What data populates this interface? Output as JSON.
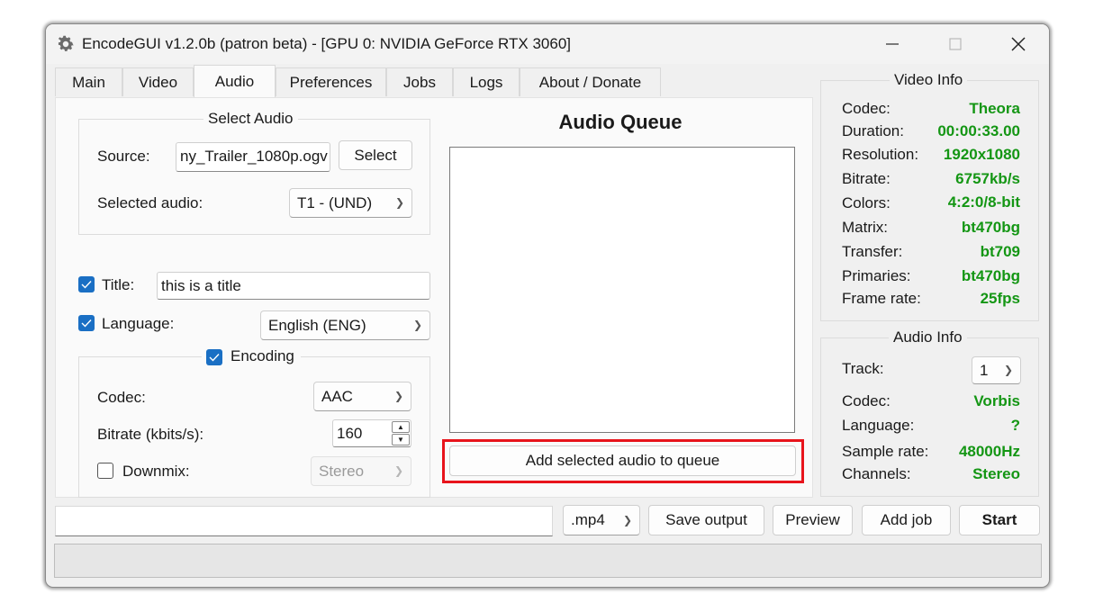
{
  "window": {
    "title": "EncodeGUI v1.2.0b (patron beta) - [GPU 0: NVIDIA GeForce RTX 3060]",
    "icons": {
      "app": "gear-icon",
      "minimize": "minimize-icon",
      "maximize": "maximize-icon",
      "close": "close-icon"
    }
  },
  "tabs": [
    {
      "label": "Main"
    },
    {
      "label": "Video"
    },
    {
      "label": "Audio",
      "active": true
    },
    {
      "label": "Preferences"
    },
    {
      "label": "Jobs"
    },
    {
      "label": "Logs"
    },
    {
      "label": "About / Donate"
    }
  ],
  "select_audio": {
    "legend": "Select Audio",
    "source_label": "Source:",
    "source_value": "ny_Trailer_1080p.ogv",
    "select_button": "Select",
    "selected_audio_label": "Selected audio:",
    "selected_audio_value": "T1 - (UND)"
  },
  "title_field": {
    "label": "Title:",
    "checked": true,
    "value": "this is a title"
  },
  "language_field": {
    "label": "Language:",
    "checked": true,
    "value": "English (ENG)"
  },
  "encoding": {
    "legend": "Encoding",
    "checked": true,
    "codec_label": "Codec:",
    "codec_value": "AAC",
    "bitrate_label": "Bitrate (kbits/s):",
    "bitrate_value": "160",
    "downmix_label": "Downmix:",
    "downmix_checked": false,
    "downmix_value": "Stereo"
  },
  "audio_queue": {
    "title": "Audio Queue",
    "add_button": "Add selected audio to queue"
  },
  "video_info": {
    "legend": "Video Info",
    "rows": [
      {
        "label": "Codec:",
        "value": "Theora"
      },
      {
        "label": "Duration:",
        "value": "00:00:33.00"
      },
      {
        "label": "Resolution:",
        "value": "1920x1080"
      },
      {
        "label": "Bitrate:",
        "value": "6757kb/s"
      },
      {
        "label": "Colors:",
        "value": "4:2:0/8-bit"
      },
      {
        "label": "Matrix:",
        "value": "bt470bg"
      },
      {
        "label": "Transfer:",
        "value": "bt709"
      },
      {
        "label": "Primaries:",
        "value": "bt470bg"
      },
      {
        "label": "Frame rate:",
        "value": "25fps"
      }
    ]
  },
  "audio_info": {
    "legend": "Audio Info",
    "track_label": "Track:",
    "track_value": "1",
    "rows": [
      {
        "label": "Codec:",
        "value": "Vorbis"
      },
      {
        "label": "Language:",
        "value": "?"
      },
      {
        "label": "Sample rate:",
        "value": "48000Hz"
      },
      {
        "label": "Channels:",
        "value": "Stereo"
      }
    ]
  },
  "bottom_bar": {
    "output_path": "",
    "container_value": ".mp4",
    "save_output": "Save output",
    "preview": "Preview",
    "add_job": "Add job",
    "start": "Start"
  },
  "colors": {
    "accent": "#1a6fc4",
    "info_value": "#149614",
    "highlight": "#e8141c"
  }
}
